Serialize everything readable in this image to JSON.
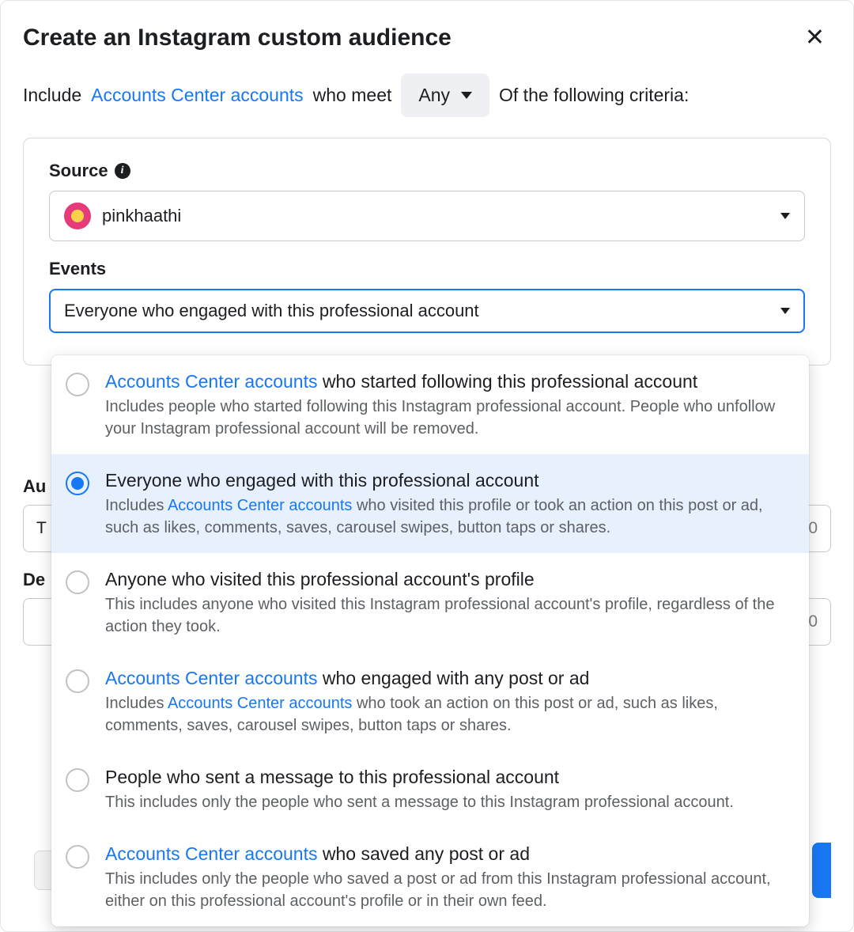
{
  "modal": {
    "title": "Create an Instagram custom audience",
    "close_glyph": "✕"
  },
  "criteria": {
    "include_text": "Include",
    "link_text": "Accounts Center accounts",
    "who_meet_text": "who meet",
    "any_label": "Any",
    "of_following_text": "Of the following criteria:"
  },
  "panel": {
    "source_label": "Source",
    "info_glyph": "i",
    "source_value": "pinkhaathi",
    "events_label": "Events",
    "events_value": "Everyone who engaged with this professional account"
  },
  "options": [
    {
      "title_link": "Accounts Center accounts",
      "title_rest": " who started following this professional account",
      "desc": "Includes people who started following this Instagram professional account. People who unfollow your Instagram professional account will be removed.",
      "desc_link": "",
      "desc_rest": "",
      "selected": false
    },
    {
      "title_link": "",
      "title_rest": "Everyone who engaged with this professional account",
      "desc": "Includes ",
      "desc_link": "Accounts Center accounts",
      "desc_rest": " who visited this profile or took an action on this post or ad, such as likes, comments, saves, carousel swipes, button taps or shares.",
      "selected": true
    },
    {
      "title_link": "",
      "title_rest": "Anyone who visited this professional account's profile",
      "desc": "This includes anyone who visited this Instagram professional account's profile, regardless of the action they took.",
      "desc_link": "",
      "desc_rest": "",
      "selected": false
    },
    {
      "title_link": "Accounts Center accounts",
      "title_rest": " who engaged with any post or ad",
      "desc": "Includes ",
      "desc_link": "Accounts Center accounts",
      "desc_rest": " who took an action on this post or ad, such as likes, comments, saves, carousel swipes, button taps or shares.",
      "selected": false
    },
    {
      "title_link": "",
      "title_rest": "People who sent a message to this professional account",
      "desc": "This includes only the people who sent a message to this Instagram professional account.",
      "desc_link": "",
      "desc_rest": "",
      "selected": false
    },
    {
      "title_link": "Accounts Center accounts",
      "title_rest": " who saved any post or ad",
      "desc": "This includes only the people who saved a post or ad from this Instagram professional account, either on this professional account's profile or in their own feed.",
      "desc_link": "",
      "desc_rest": "",
      "selected": false
    }
  ],
  "background": {
    "audience_label_fragment": "Au",
    "audience_input_hint_fragment": "T",
    "audience_input_right_fragment": "0",
    "description_label_fragment": "De",
    "description_input_right_fragment": "0"
  }
}
